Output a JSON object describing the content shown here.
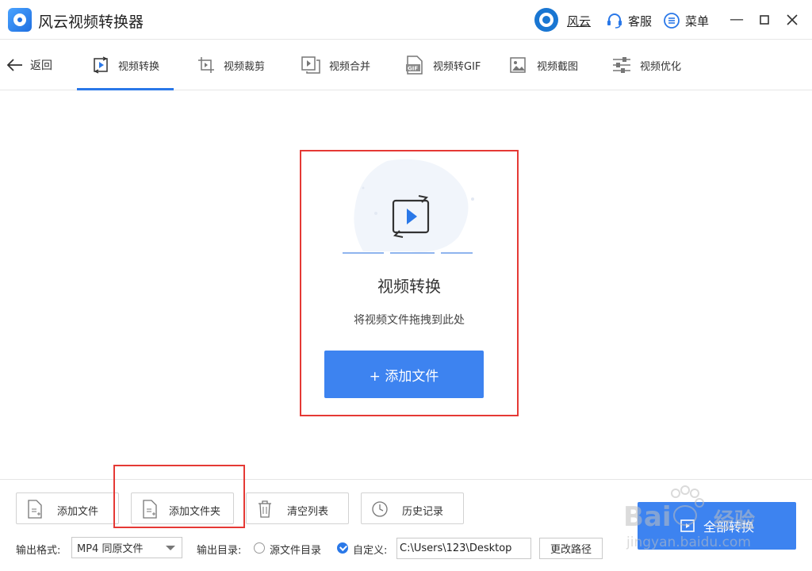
{
  "titlebar": {
    "app_title": "风云视频转换器",
    "user_name": "风云",
    "service_label": "客服",
    "menu_label": "菜单",
    "icons": {
      "logo": "app-logo-icon",
      "service": "headset-icon",
      "menu": "menu-list-icon"
    }
  },
  "tabs": {
    "back_label": "返回",
    "items": [
      {
        "label": "视频转换",
        "icon": "video-convert-icon",
        "active": true
      },
      {
        "label": "视频裁剪",
        "icon": "video-crop-icon",
        "active": false
      },
      {
        "label": "视频合并",
        "icon": "video-merge-icon",
        "active": false
      },
      {
        "label": "视频转GIF",
        "icon": "gif-icon",
        "active": false
      },
      {
        "label": "视频截图",
        "icon": "screenshot-icon",
        "active": false
      },
      {
        "label": "视频优化",
        "icon": "optimize-sliders-icon",
        "active": false
      }
    ]
  },
  "dropzone": {
    "title": "视频转换",
    "hint": "将视频文件拖拽到此处",
    "add_button": "+ 添加文件"
  },
  "toolbar": {
    "add_file": "添加文件",
    "add_folder": "添加文件夹",
    "clear_list": "清空列表",
    "history": "历史记录",
    "convert_all": "全部转换"
  },
  "output": {
    "format_label": "输出格式:",
    "format_value": "MP4 同原文件",
    "dir_label": "输出目录:",
    "source_dir_option": "源文件目录",
    "custom_option": "自定义:",
    "custom_path": "C:\\Users\\123\\Desktop",
    "change_path": "更改路径"
  },
  "watermark": {
    "brand": "Bai",
    "brand_cn": "经验",
    "url": "jingyan.baidu.com"
  },
  "colors": {
    "accent": "#3d83f0",
    "highlight": "#e53935"
  }
}
